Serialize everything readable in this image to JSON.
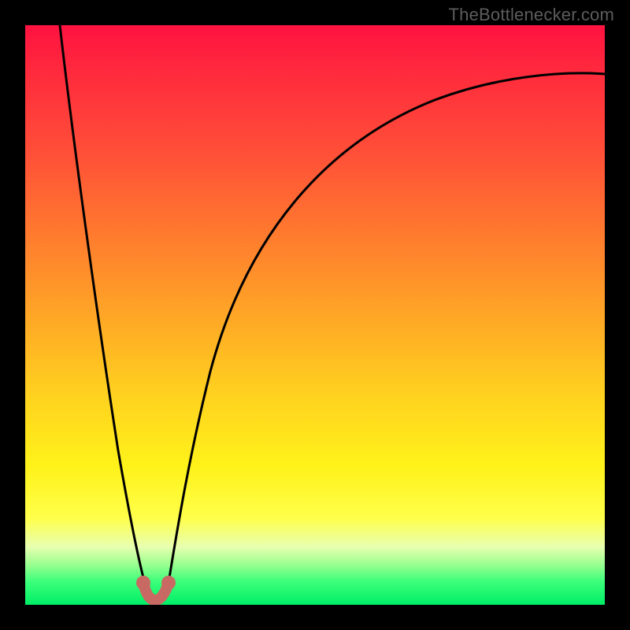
{
  "attribution": "TheBottlenecker.com",
  "chart_data": {
    "type": "line",
    "title": "",
    "xlabel": "",
    "ylabel": "",
    "xlim": [
      0,
      100
    ],
    "ylim": [
      0,
      100
    ],
    "series": [
      {
        "name": "left-falling-curve",
        "x": [
          4,
          6,
          8,
          10,
          12,
          14,
          16,
          18,
          20,
          21
        ],
        "values": [
          100,
          88,
          76,
          64,
          52,
          40,
          28,
          16,
          6,
          2
        ]
      },
      {
        "name": "right-rising-curve",
        "x": [
          24,
          26,
          28,
          32,
          38,
          46,
          56,
          68,
          82,
          100
        ],
        "values": [
          2,
          10,
          20,
          36,
          52,
          64,
          74,
          82,
          87,
          90
        ]
      },
      {
        "name": "valley-points",
        "x": [
          20,
          21.5,
          23,
          24
        ],
        "values": [
          3,
          2,
          2,
          3
        ]
      }
    ],
    "colors": {
      "curve": "#000000",
      "valley_dot": "#c86a63"
    }
  }
}
